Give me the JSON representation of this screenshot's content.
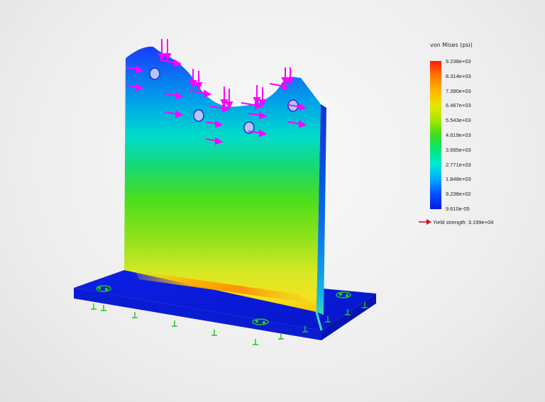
{
  "legend": {
    "title": "von Mises (psi)",
    "ticks": [
      "9.238e+03",
      "8.314e+03",
      "7.390e+03",
      "6.467e+03",
      "5.543e+03",
      "4.619e+03",
      "3.695e+03",
      "2.771e+03",
      "1.848e+03",
      "9.238e+02",
      "9.610e-05"
    ],
    "yield_label": "Yield strength: 3.199e+04",
    "yield_arrow_color": "#e8001a"
  },
  "model": {
    "load_arrow_color": "#ff00ff",
    "fixture_color": "#22c522",
    "base_color": "#0a1ee0"
  }
}
